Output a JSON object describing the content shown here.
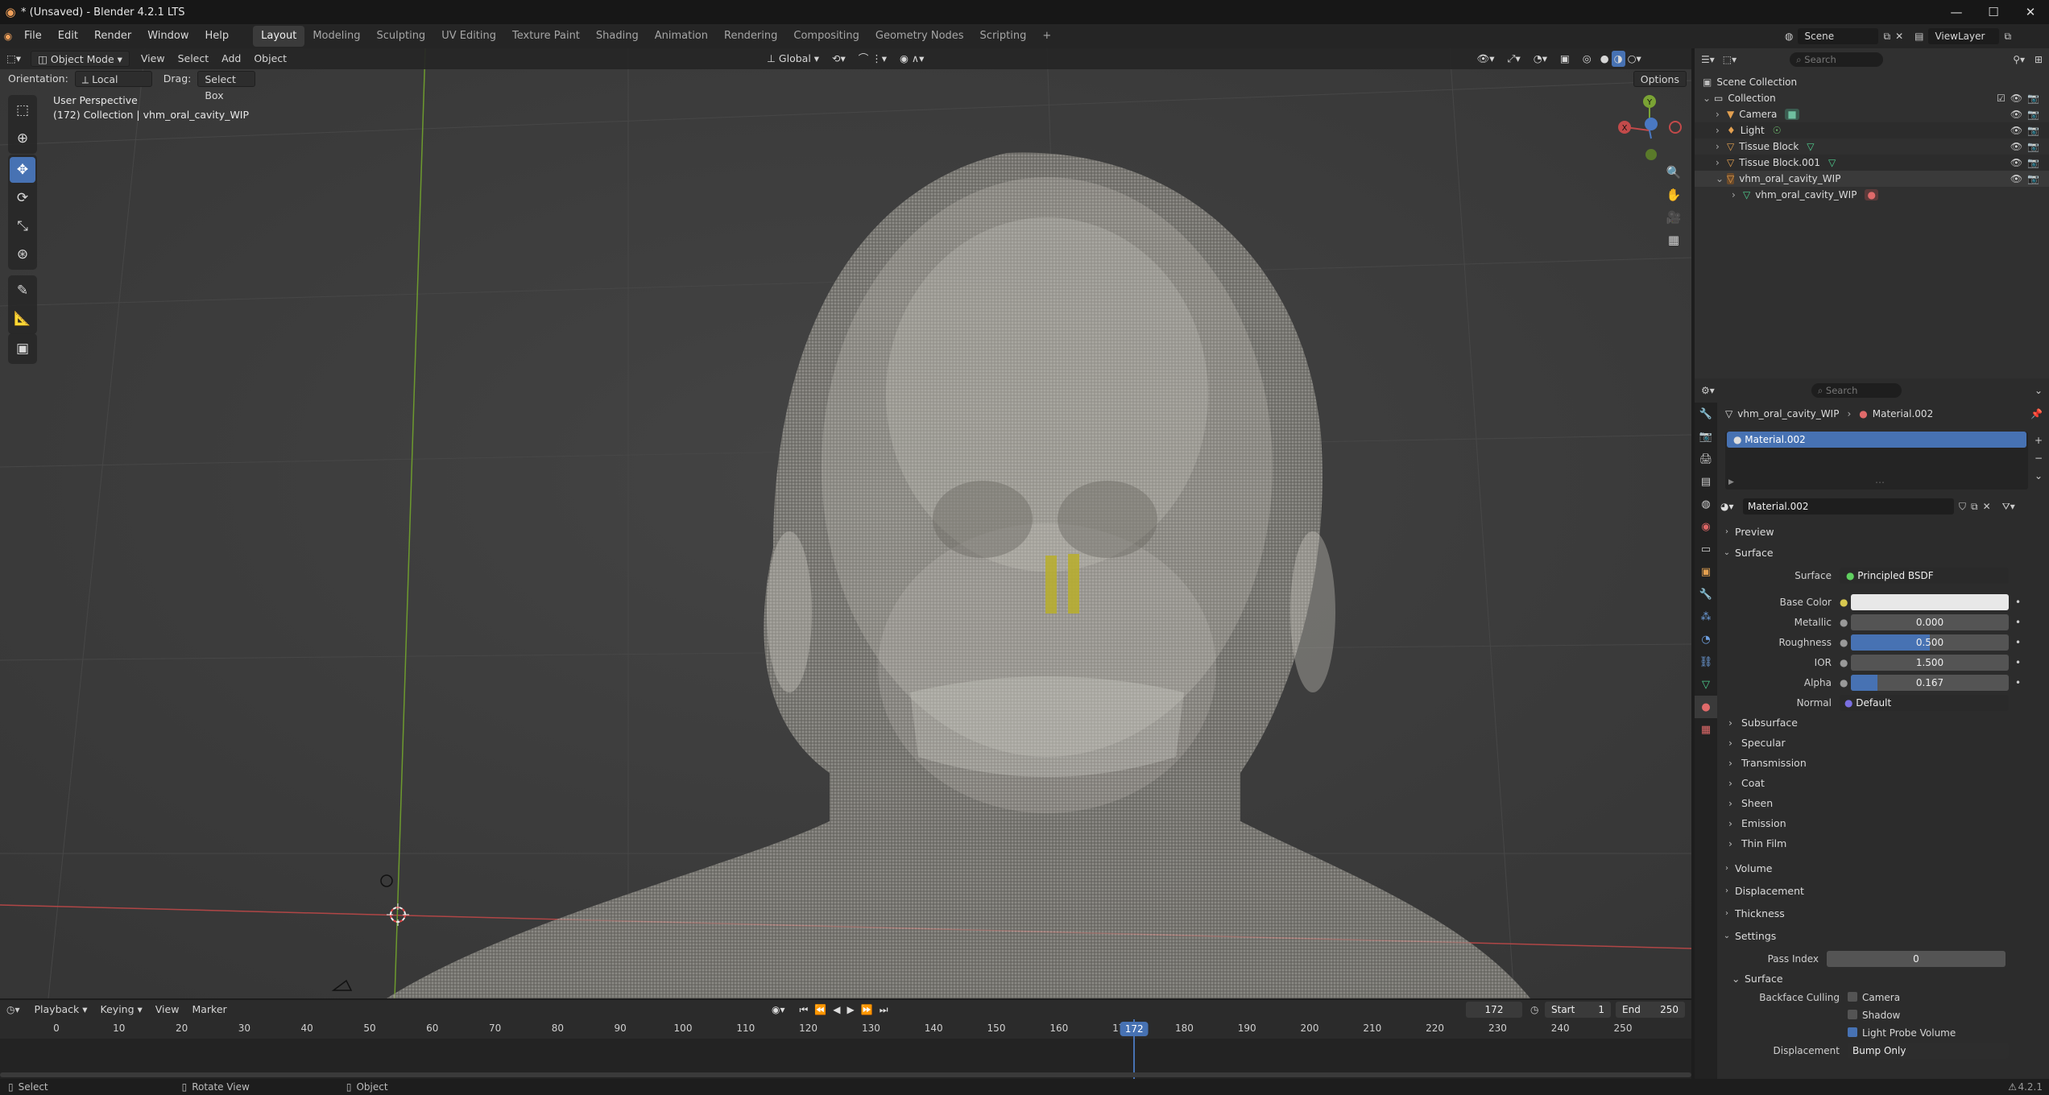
{
  "window": {
    "title": "* (Unsaved) - Blender 4.2.1 LTS"
  },
  "menus": [
    "File",
    "Edit",
    "Render",
    "Window",
    "Help"
  ],
  "workspaces": [
    "Layout",
    "Modeling",
    "Sculpting",
    "UV Editing",
    "Texture Paint",
    "Shading",
    "Animation",
    "Rendering",
    "Compositing",
    "Geometry Nodes",
    "Scripting"
  ],
  "active_workspace": "Layout",
  "scene": {
    "name": "Scene",
    "view_layer": "ViewLayer"
  },
  "viewport": {
    "mode": "Object Mode",
    "menus": [
      "View",
      "Select",
      "Add",
      "Object"
    ],
    "transform_orientation": "Global",
    "orientation_label": "Orientation:",
    "orientation_value": "Local",
    "drag_label": "Drag:",
    "drag_value": "Select Box",
    "options_label": "Options",
    "overlay_line1": "User Perspective",
    "overlay_line2": "(172) Collection | vhm_oral_cavity_WIP",
    "gizmo": {
      "x": "X",
      "y": "Y"
    }
  },
  "outliner": {
    "search_placeholder": "Search",
    "scene_collection": "Scene Collection",
    "collection": "Collection",
    "items": [
      {
        "name": "Camera"
      },
      {
        "name": "Light"
      },
      {
        "name": "Tissue Block"
      },
      {
        "name": "Tissue Block.001"
      },
      {
        "name": "vhm_oral_cavity_WIP"
      }
    ],
    "child": "vhm_oral_cavity_WIP"
  },
  "properties": {
    "search_placeholder": "Search",
    "breadcrumb_object": "vhm_oral_cavity_WIP",
    "breadcrumb_material": "Material.002",
    "slot": "Material.002",
    "material_name": "Material.002",
    "panels": {
      "preview": "Preview",
      "surface": "Surface",
      "subsurface": "Subsurface",
      "specular": "Specular",
      "transmission": "Transmission",
      "coat": "Coat",
      "sheen": "Sheen",
      "emission": "Emission",
      "thin_film": "Thin Film",
      "volume": "Volume",
      "displacement": "Displacement",
      "thickness": "Thickness",
      "settings": "Settings"
    },
    "surface_label": "Surface",
    "surface_value": "Principled BSDF",
    "base_color_label": "Base Color",
    "metallic": {
      "label": "Metallic",
      "value": "0.000",
      "fraction": 0
    },
    "roughness": {
      "label": "Roughness",
      "value": "0.500",
      "fraction": 0.5
    },
    "ior": {
      "label": "IOR",
      "value": "1.500"
    },
    "alpha": {
      "label": "Alpha",
      "value": "0.167",
      "fraction": 0.167
    },
    "normal": {
      "label": "Normal",
      "value": "Default"
    },
    "pass_index": {
      "label": "Pass Index",
      "value": "0"
    },
    "settings_surface": "Surface",
    "backface_culling": "Backface Culling",
    "camera": "Camera",
    "shadow": "Shadow",
    "light_probe_volume": "Light Probe Volume",
    "displacement_label": "Displacement",
    "displacement_value": "Bump Only"
  },
  "timeline": {
    "menus": [
      "Playback",
      "Keying",
      "View",
      "Marker"
    ],
    "current_frame": "172",
    "start_label": "Start",
    "start": "1",
    "end_label": "End",
    "end": "250",
    "ticks": [
      "0",
      "10",
      "20",
      "30",
      "40",
      "50",
      "60",
      "70",
      "80",
      "90",
      "100",
      "110",
      "120",
      "130",
      "140",
      "150",
      "160",
      "170",
      "180",
      "190",
      "200",
      "210",
      "220",
      "230",
      "240",
      "250"
    ],
    "playhead": "172"
  },
  "status": {
    "select": "Select",
    "rotate": "Rotate View",
    "object": "Object",
    "version": "4.2.1"
  },
  "colors": {
    "accent": "#4772b3",
    "viewport_bg": "#3d3d3d",
    "x_axis": "#c24a4a",
    "y_axis": "#7aa334"
  }
}
